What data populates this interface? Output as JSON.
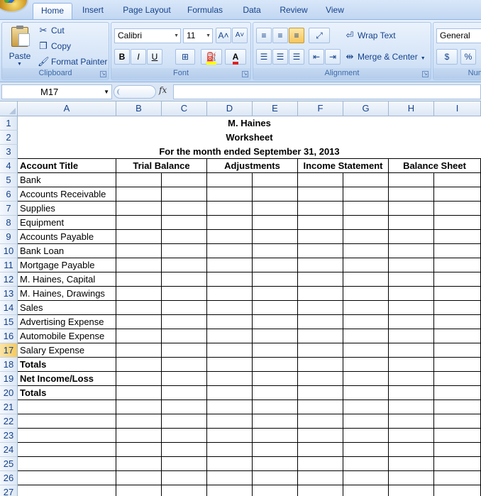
{
  "tabs": [
    "Home",
    "Insert",
    "Page Layout",
    "Formulas",
    "Data",
    "Review",
    "View"
  ],
  "clipboard": {
    "group_label": "Clipboard",
    "paste": "Paste",
    "cut": "Cut",
    "copy": "Copy",
    "format_painter": "Format Painter"
  },
  "font": {
    "group_label": "Font",
    "font_name": "Calibri",
    "font_size": "11",
    "grow": "A˄",
    "shrink": "A˅",
    "bold": "B",
    "italic": "I",
    "underline": "U",
    "font_color_letter": "A"
  },
  "alignment": {
    "group_label": "Alignment",
    "wrap_text": "Wrap Text",
    "merge_center": "Merge & Center"
  },
  "number": {
    "group_label": "Numb",
    "format": "General",
    "currency": "$",
    "percent": "%"
  },
  "formula_bar": {
    "name_box": "M17",
    "fx": "fx",
    "value": ""
  },
  "columns": [
    "A",
    "B",
    "C",
    "D",
    "E",
    "F",
    "G",
    "H",
    "I"
  ],
  "rows": [
    "1",
    "2",
    "3",
    "4",
    "5",
    "6",
    "7",
    "8",
    "9",
    "10",
    "11",
    "12",
    "13",
    "14",
    "15",
    "16",
    "17",
    "18",
    "19",
    "20",
    "21",
    "22",
    "23",
    "24",
    "25",
    "26",
    "27"
  ],
  "selected_row": "17",
  "sheet": {
    "title_line1": "M. Haines",
    "title_line2": "Worksheet",
    "title_line3": "For the month ended September 31, 2013",
    "account_header": "Account Title",
    "groups": [
      "Trial Balance",
      "Adjustments",
      "Income Statement",
      "Balance Sheet"
    ],
    "accounts": [
      {
        "label": "Bank",
        "bold": false
      },
      {
        "label": "Accounts Receivable",
        "bold": false
      },
      {
        "label": "Supplies",
        "bold": false
      },
      {
        "label": "Equipment",
        "bold": false
      },
      {
        "label": "Accounts Payable",
        "bold": false
      },
      {
        "label": "Bank Loan",
        "bold": false
      },
      {
        "label": "Mortgage Payable",
        "bold": false
      },
      {
        "label": "M. Haines, Capital",
        "bold": false
      },
      {
        "label": "M. Haines, Drawings",
        "bold": false
      },
      {
        "label": "Sales",
        "bold": false
      },
      {
        "label": "Advertising Expense",
        "bold": false
      },
      {
        "label": "Automobile Expense",
        "bold": false
      },
      {
        "label": "Salary Expense",
        "bold": false
      },
      {
        "label": "Totals",
        "bold": true
      },
      {
        "label": "Net Income/Loss",
        "bold": true
      },
      {
        "label": "Totals",
        "bold": true
      },
      {
        "label": "",
        "bold": false
      },
      {
        "label": "",
        "bold": false
      },
      {
        "label": "",
        "bold": false
      },
      {
        "label": "",
        "bold": false
      },
      {
        "label": "",
        "bold": false
      },
      {
        "label": "",
        "bold": false
      },
      {
        "label": "",
        "bold": false
      }
    ]
  },
  "colors": {
    "accent": "#15428b",
    "ribbon": "#d6e5f7",
    "selected_row": "#f5c95c"
  }
}
